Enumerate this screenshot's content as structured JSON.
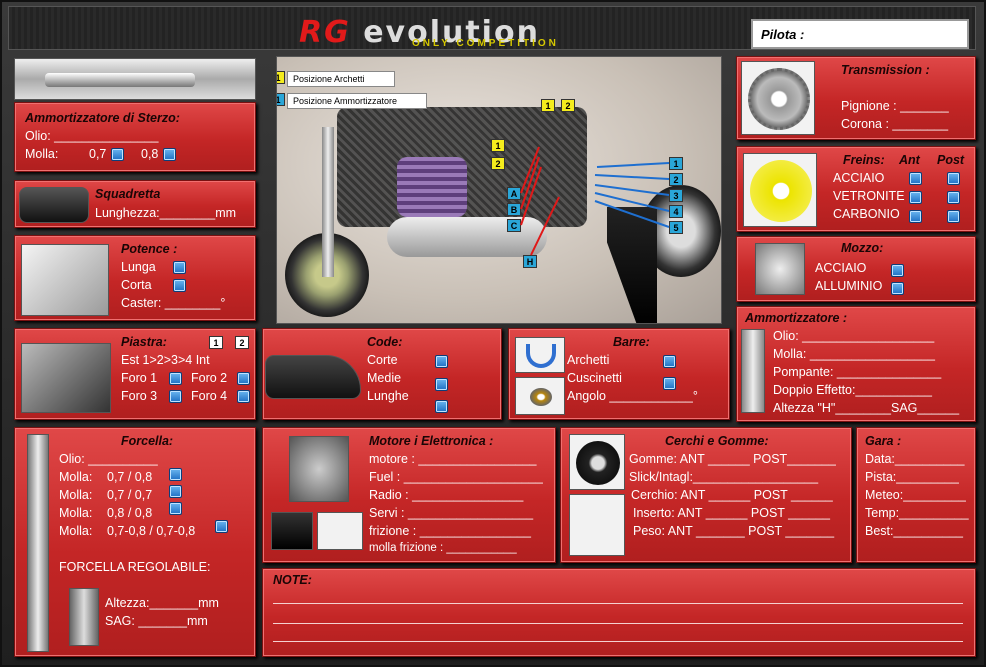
{
  "header": {
    "logo_brand": "RG",
    "logo_word": "evolution",
    "logo_tag": "ONLY COMPETITION",
    "pilota_label": "Pilota :"
  },
  "ammortizzatore_sterzo": {
    "title": "Ammortizzatore di Sterzo:",
    "olio": "Olio: _______________",
    "molla": "Molla:",
    "opt1": "0,7",
    "opt2": "0,8"
  },
  "squadretta": {
    "title": "Squadretta",
    "lunghezza": "Lunghezza:________mm"
  },
  "potence": {
    "title": "Potence :",
    "items": [
      "Lunga",
      "Corta"
    ],
    "caster": "Caster: ________°"
  },
  "piastra": {
    "title": "Piastra:",
    "n1": "1",
    "n2": "2",
    "est": "Est 1>2>3>4  Int",
    "foro1": "Foro 1",
    "foro2": "Foro 2",
    "foro3": "Foro 3",
    "foro4": "Foro 4"
  },
  "code": {
    "title": "Code:",
    "items": [
      "Corte",
      "Medie",
      "Lunghe"
    ]
  },
  "barre": {
    "title": "Barre:",
    "items": [
      "Archetti",
      "Cuscinetti"
    ],
    "angolo": "Angolo ____________°"
  },
  "forcella": {
    "title": "Forcella:",
    "olio": "Olio: __________",
    "molla_label": "Molla:",
    "mollas": [
      "0,7 / 0,8",
      "0,7 / 0,7",
      "0,8 / 0,8",
      "0,7-0,8 / 0,7-0,8"
    ],
    "regolabile": "FORCELLA REGOLABILE:",
    "altezza": "Altezza:_______mm",
    "sag": "SAG:       _______mm"
  },
  "motore": {
    "title": "Motore  i Elettronica :",
    "rows": [
      "motore : _________________",
      "Fuel : ____________________",
      "Radio    : ________________",
      "Servi  : __________________",
      "frizione  : ________________",
      "molla frizione : ___________"
    ]
  },
  "cerchi": {
    "title": "Cerchi  e Gomme:",
    "rows": [
      "Gomme: ANT ______  POST_______",
      "Slick/Intagl:__________________",
      "Cerchio: ANT ______  POST ______",
      "Inserto:  ANT ______  POST ______",
      "Peso:  ANT _______  POST _______"
    ]
  },
  "gara": {
    "title": "Gara :",
    "rows": [
      "Data:__________",
      "Pista:_________",
      "Meteo:_________",
      "Temp:__________",
      "Best:__________"
    ]
  },
  "note": {
    "title": "NOTE:"
  },
  "transmission": {
    "title": "Transmission :",
    "pignione": "Pignione : _______",
    "corona": "Corona : ________"
  },
  "freins": {
    "title": "Freins:",
    "ant": "Ant",
    "post": "Post",
    "items": [
      "ACCIAIO",
      "VETRONITE",
      "CARBONIO"
    ]
  },
  "mozzo": {
    "title": "Mozzo:",
    "items": [
      "ACCIAIO",
      "ALLUMINIO"
    ]
  },
  "ammortizzatore": {
    "title": "Ammortizzatore :",
    "rows": [
      "Olio: ___________________",
      "Molla: __________________",
      "Pompante: _______________",
      "Doppio Effetto:___________",
      "Altezza \"H\"________SAG______"
    ]
  },
  "photo": {
    "legend_archetti_num": "1",
    "legend_archetti": "Posizione Archetti",
    "legend_amm_num": "1",
    "legend_amm": "Posizione Ammortizzatore",
    "yellow": [
      "1",
      "2",
      "1",
      "2"
    ],
    "blue": [
      "1",
      "2",
      "3",
      "4",
      "5"
    ],
    "letters": [
      "A",
      "B",
      "C",
      "H"
    ]
  },
  "colors": {
    "panel": "#c42626",
    "checkbox": "#1d6fc4",
    "header_bg": "#232323"
  }
}
